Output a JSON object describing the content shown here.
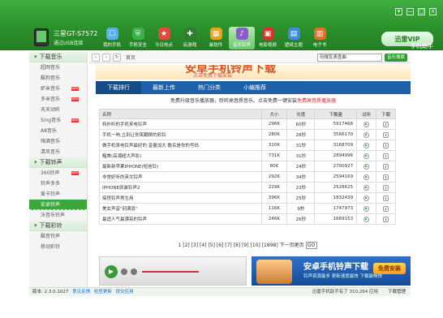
{
  "header": {
    "device_name": "三星GT-S7572",
    "device_status": "通过USB连接",
    "vip_label": "迅雷VIP",
    "vip_sub": "手机助手",
    "window_controls": [
      "▾",
      "—",
      "□",
      "×"
    ],
    "nav": [
      {
        "label": "我的手机",
        "icon": "phone-icon",
        "color": "#5ab0e8"
      },
      {
        "label": "手机安全",
        "icon": "shield-icon",
        "color": "#37b24d"
      },
      {
        "label": "今日热点",
        "icon": "star-icon",
        "color": "#e04b3a"
      },
      {
        "label": "玩游戏",
        "icon": "gamepad-icon",
        "color": "#2e7d32"
      },
      {
        "label": "装软件",
        "icon": "app-grid-icon",
        "color": "#f0a020"
      },
      {
        "label": "音乐铃声",
        "icon": "music-note-icon",
        "color": "#8b5cc7",
        "active": true
      },
      {
        "label": "电影视频",
        "icon": "film-icon",
        "color": "#d9322b"
      },
      {
        "label": "壁纸主题",
        "icon": "image-icon",
        "color": "#3c8de0"
      },
      {
        "label": "电子书",
        "icon": "book-icon",
        "color": "#e56f27"
      }
    ]
  },
  "sidebar": {
    "groups": [
      {
        "title": "下载音乐",
        "items": [
          {
            "label": "超网音乐"
          },
          {
            "label": "酷狗音乐"
          },
          {
            "label": "虾米音乐",
            "new": true
          },
          {
            "label": "多米音乐",
            "new": true
          },
          {
            "label": "天天动听"
          },
          {
            "label": "Sing音乐",
            "new": true
          },
          {
            "label": "A8音乐"
          },
          {
            "label": "嗨酒音乐"
          },
          {
            "label": "清风音乐"
          }
        ]
      },
      {
        "title": "下载铃声",
        "items": [
          {
            "label": "360铃声",
            "new": true
          },
          {
            "label": "铃声多多"
          },
          {
            "label": "爱卡铃声"
          },
          {
            "label": "安卓铃声",
            "active": true
          },
          {
            "label": "沃音乐铃声"
          }
        ]
      },
      {
        "title": "下载彩铃",
        "items": [
          {
            "label": "酷音铃声"
          },
          {
            "label": "移动彩铃"
          }
        ]
      }
    ]
  },
  "address": {
    "home": "首页",
    "search_value": "玛搜瓦表查曲",
    "search_button": "音乐搜索"
  },
  "banner": {
    "title": "安卓手机铃声下载",
    "subtitle": "点击免费下载安装"
  },
  "tabs": [
    "下载排行",
    "最新上传",
    "热门分类",
    "小编推荐"
  ],
  "notice": {
    "prefix": "免费升级音乐播放器，聆听高音质音乐。点击免费一键安装",
    "highlight": "免费高音质播放器"
  },
  "table": {
    "headers": [
      "名称",
      "大小",
      "长度",
      "下载量",
      "试听",
      "下载"
    ],
    "rows": [
      [
        "特外听的手机来电铃声",
        "296K",
        "60秒",
        "5917468"
      ],
      [
        "手机一响,立刻让你笑翻倒的彩铃",
        "280K",
        "28秒",
        "3566170"
      ],
      [
        "做手机来电铃声最好的 音量加大 歌名是你的号码",
        "310K",
        "31秒",
        "3168709"
      ],
      [
        "黯美(高潮超大声影)",
        "731K",
        "31秒",
        "2894996"
      ],
      [
        "最新新苹果IPHONE(短信铃)",
        "80K",
        "24秒",
        "2700927"
      ],
      [
        "非常好听的英文铃声",
        "292K",
        "34秒",
        "2594169"
      ],
      [
        "IPHONE原装铃声2",
        "229K",
        "23秒",
        "2528625"
      ],
      [
        "搞怪铃声男生用",
        "396K",
        "25秒",
        "1832439"
      ],
      [
        "美女声音\"别满息\"",
        "116K",
        "9秒",
        "1747973"
      ],
      [
        "最适人气最漂亮的铃声",
        "246K",
        "26秒",
        "1669153"
      ]
    ],
    "play_symbol": "▶",
    "download_symbol": "⬇"
  },
  "pager": {
    "pages": "1 [2] [3] [4] [5] [6] [7] [8] [9] [10]",
    "total": "[1898] 下一页尾页",
    "go": "GO"
  },
  "player": {
    "play_symbol": "▶"
  },
  "ad": {
    "title": "安卓手机铃声下载",
    "subtitle": "铃声资源最多 更新速度最快 下载最畅快",
    "button": "免费安装"
  },
  "footer": {
    "version": "版本: 2.3.0.1027",
    "links": [
      "意见反馈",
      "检查更新",
      "提交应用"
    ],
    "right_text": "迅雷手机助手有了 310,284 应用",
    "download_manage": "下载管理"
  }
}
